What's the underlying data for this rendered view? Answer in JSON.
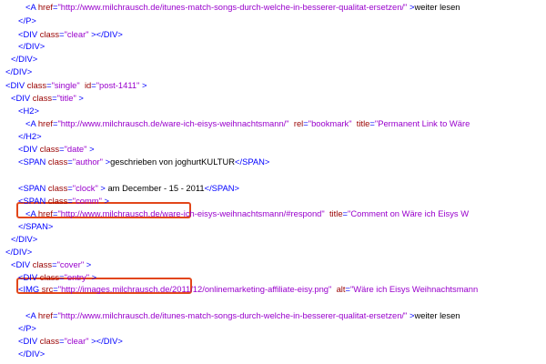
{
  "colors": {
    "tag": "#0000ff",
    "attribute": "#990000",
    "value": "#9900cc",
    "text": "#000000",
    "highlight": "#e2461a"
  },
  "lines": [
    [
      [
        "tag",
        "<A "
      ],
      [
        "attr",
        "href"
      ],
      [
        "tag",
        "="
      ],
      [
        "val",
        "\"http://www.milchrausch.de/itunes-match-songs-durch-welche-in-besserer-qualitat-ersetzen/\""
      ],
      [
        "tag",
        " >"
      ],
      [
        "txt",
        "weiter lesen"
      ]
    ],
    [
      [
        "tag",
        "</P>"
      ]
    ],
    [
      [
        "tag",
        "<DIV "
      ],
      [
        "attr",
        "class"
      ],
      [
        "tag",
        "="
      ],
      [
        "val",
        "\"clear\""
      ],
      [
        "tag",
        " ></DIV>"
      ]
    ],
    [
      [
        "tag",
        "</DIV>"
      ]
    ],
    [
      [
        "tag",
        "</DIV>"
      ]
    ],
    [
      [
        "tag",
        "</DIV>"
      ]
    ],
    [
      [
        "tag",
        "<DIV "
      ],
      [
        "attr",
        "class"
      ],
      [
        "tag",
        "="
      ],
      [
        "val",
        "\"single\""
      ],
      [
        "tag",
        "  "
      ],
      [
        "attr",
        "id"
      ],
      [
        "tag",
        "="
      ],
      [
        "val",
        "\"post-1411\""
      ],
      [
        "tag",
        " >"
      ]
    ],
    [
      [
        "tag",
        "<DIV "
      ],
      [
        "attr",
        "class"
      ],
      [
        "tag",
        "="
      ],
      [
        "val",
        "\"title\""
      ],
      [
        "tag",
        " >"
      ]
    ],
    [
      [
        "tag",
        "<H2>"
      ]
    ],
    [
      [
        "tag",
        "<A "
      ],
      [
        "attr",
        "href"
      ],
      [
        "tag",
        "="
      ],
      [
        "val",
        "\"http://www.milchrausch.de/ware-ich-eisys-weihnachtsmann/\""
      ],
      [
        "tag",
        "  "
      ],
      [
        "attr",
        "rel"
      ],
      [
        "tag",
        "="
      ],
      [
        "val",
        "\"bookmark\""
      ],
      [
        "tag",
        "  "
      ],
      [
        "attr",
        "title"
      ],
      [
        "tag",
        "="
      ],
      [
        "val",
        "\"Permanent Link to Wäre"
      ]
    ],
    [
      [
        "tag",
        "</H2>"
      ]
    ],
    [
      [
        "tag",
        "<DIV "
      ],
      [
        "attr",
        "class"
      ],
      [
        "tag",
        "="
      ],
      [
        "val",
        "\"date\""
      ],
      [
        "tag",
        " >"
      ]
    ],
    [
      [
        "tag",
        "<SPAN "
      ],
      [
        "attr",
        "class"
      ],
      [
        "tag",
        "="
      ],
      [
        "val",
        "\"author\""
      ],
      [
        "tag",
        " >"
      ],
      [
        "txt",
        "geschrieben von joghurtKULTUR"
      ],
      [
        "tag",
        "</SPAN>"
      ]
    ],
    [],
    [
      [
        "tag",
        "<SPAN "
      ],
      [
        "attr",
        "class"
      ],
      [
        "tag",
        "="
      ],
      [
        "val",
        "\"clock\""
      ],
      [
        "tag",
        " > "
      ],
      [
        "txt",
        "am December - 15 - 2011"
      ],
      [
        "tag",
        "</SPAN>"
      ]
    ],
    [
      [
        "tag",
        "<SPAN "
      ],
      [
        "attr",
        "class"
      ],
      [
        "tag",
        "="
      ],
      [
        "val",
        "\"comm\""
      ],
      [
        "tag",
        " >"
      ]
    ],
    [
      [
        "tag",
        "<A "
      ],
      [
        "attr",
        "href"
      ],
      [
        "tag",
        "="
      ],
      [
        "val",
        "\"http://www.milchrausch.de/ware-ich-eisys-weihnachtsmann/#respond\""
      ],
      [
        "tag",
        "  "
      ],
      [
        "attr",
        "title"
      ],
      [
        "tag",
        "="
      ],
      [
        "val",
        "\"Comment on Wäre ich Eisys W"
      ]
    ],
    [
      [
        "tag",
        "</SPAN>"
      ]
    ],
    [
      [
        "tag",
        "</DIV>"
      ]
    ],
    [
      [
        "tag",
        "</DIV>"
      ]
    ],
    [
      [
        "tag",
        "<DIV "
      ],
      [
        "attr",
        "class"
      ],
      [
        "tag",
        "="
      ],
      [
        "val",
        "\"cover\""
      ],
      [
        "tag",
        " >"
      ]
    ],
    [
      [
        "tag",
        "<DIV "
      ],
      [
        "attr",
        "class"
      ],
      [
        "tag",
        "="
      ],
      [
        "val",
        "\"entry\""
      ],
      [
        "tag",
        " >"
      ]
    ],
    [
      [
        "tag",
        "<IMG "
      ],
      [
        "attr",
        "src"
      ],
      [
        "tag",
        "="
      ],
      [
        "val",
        "\"http://images.milchrausch.de/2011/12/onlinemarketing-affiliate-eisy.png\""
      ],
      [
        "tag",
        "  "
      ],
      [
        "attr",
        "alt"
      ],
      [
        "tag",
        "="
      ],
      [
        "val",
        "\"Wäre ich Eisys Weihnachtsmann"
      ]
    ],
    [],
    [
      [
        "tag",
        "<A "
      ],
      [
        "attr",
        "href"
      ],
      [
        "tag",
        "="
      ],
      [
        "val",
        "\"http://www.milchrausch.de/itunes-match-songs-durch-welche-in-besserer-qualitat-ersetzen/\""
      ],
      [
        "tag",
        " >"
      ],
      [
        "txt",
        "weiter lesen"
      ]
    ],
    [
      [
        "tag",
        "</P>"
      ]
    ],
    [
      [
        "tag",
        "<DIV "
      ],
      [
        "attr",
        "class"
      ],
      [
        "tag",
        "="
      ],
      [
        "val",
        "\"clear\""
      ],
      [
        "tag",
        " ></DIV>"
      ]
    ],
    [
      [
        "tag",
        "</DIV>"
      ]
    ]
  ]
}
